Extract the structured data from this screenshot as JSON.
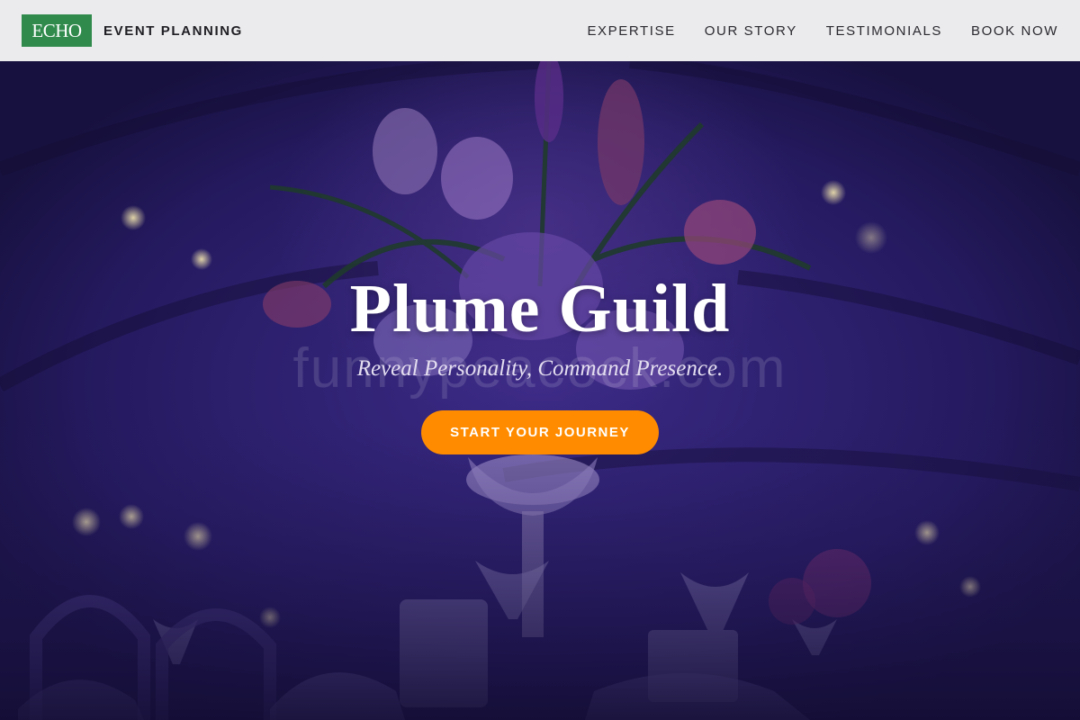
{
  "header": {
    "logo_text": "ECHO",
    "brand_name": "EVENT PLANNING",
    "nav": [
      {
        "label": "EXPERTISE"
      },
      {
        "label": "OUR STORY"
      },
      {
        "label": "TESTIMONIALS"
      },
      {
        "label": "BOOK NOW"
      }
    ]
  },
  "hero": {
    "title": "Plume Guild",
    "subtitle": "Reveal Personality, Command Presence.",
    "cta_label": "START YOUR JOURNEY",
    "watermark": "funnypeacock.com"
  },
  "colors": {
    "header_bg": "#ebebed",
    "logo_bg": "#2f8a4c",
    "cta_bg": "#ff8c00",
    "hero_tint": "#2e2170"
  }
}
